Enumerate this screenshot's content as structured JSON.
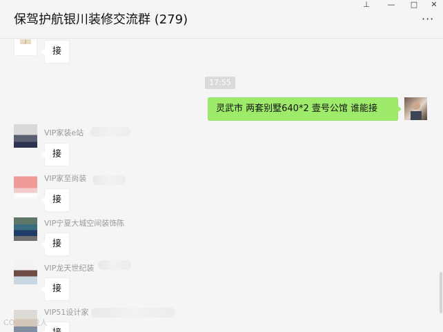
{
  "window": {
    "title": "保驾护航银川装修交流群 (279)",
    "pin_glyph": "⊥",
    "min_glyph": "—",
    "max_glyph": "□",
    "close_glyph": "✕",
    "more_glyph": "···"
  },
  "chat": {
    "timestamp": "17:55",
    "messages": [
      {
        "sender": "",
        "text": "接",
        "outgoing": false
      },
      {
        "sender": "",
        "text": "灵武市 两套别墅640*2  壹号公馆  谁能接",
        "outgoing": true
      },
      {
        "sender": "VIP家装e站",
        "text": "接",
        "outgoing": false
      },
      {
        "sender": "VIP家至尚装",
        "text": "接",
        "outgoing": false
      },
      {
        "sender": "VIP宁夏大城空间装饰陈",
        "text": "接",
        "outgoing": false
      },
      {
        "sender": "VIP龙天世纪装",
        "text": "接",
        "outgoing": false
      },
      {
        "sender": "VIP51设计家",
        "text": "接",
        "outgoing": false
      }
    ]
  },
  "watermark": "CO 人民说人"
}
